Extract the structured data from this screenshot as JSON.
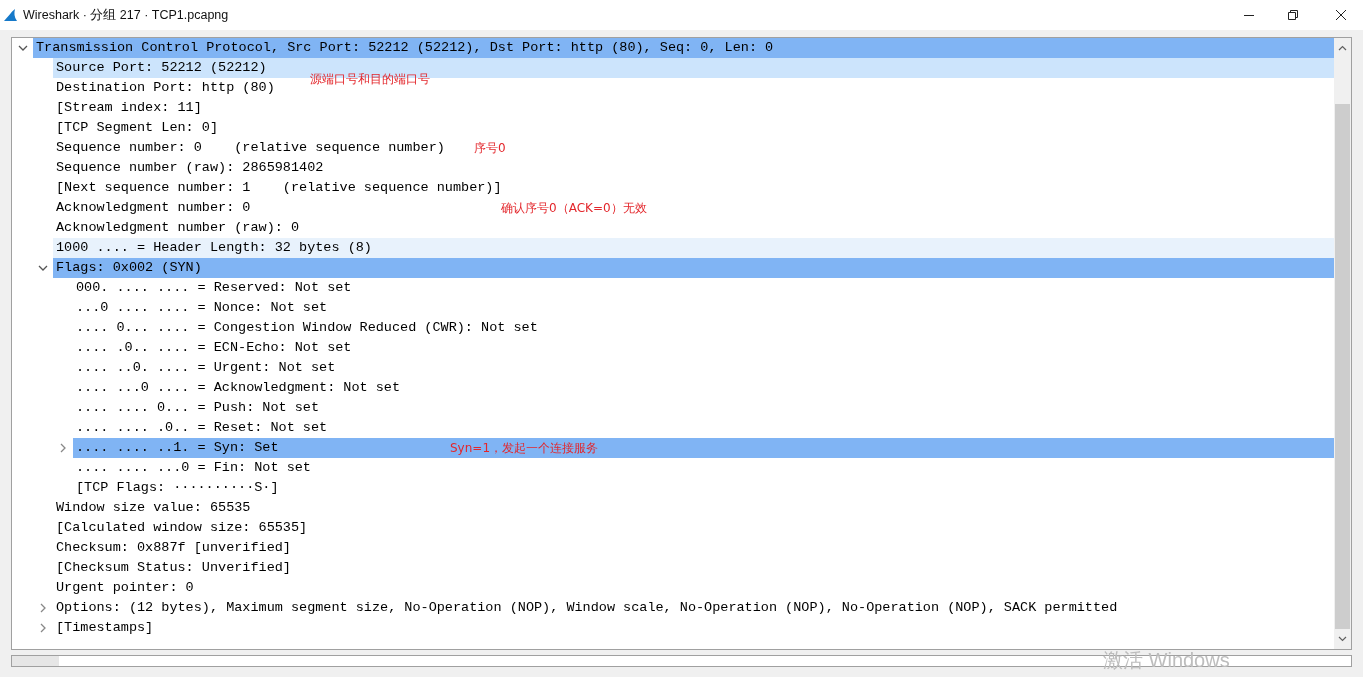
{
  "window": {
    "title": "Wireshark · 分组 217 · TCP1.pcapng"
  },
  "tree": [
    {
      "text": "Transmission Control Protocol, Src Port: 52212 (52212), Dst Port: http (80), Seq: 0, Len: 0",
      "selected": true,
      "expanded": true,
      "children": [
        {
          "text": "Source Port: 52212 (52212)",
          "selected": false,
          "hovered": true,
          "related": false
        },
        {
          "text": "Destination Port: http (80)",
          "selected": false,
          "hovered": false,
          "related": false,
          "note": "源端口号和目的端口号"
        },
        {
          "text": "[Stream index: 11]",
          "selected": false,
          "hovered": false,
          "related": false
        },
        {
          "text": "[TCP Segment Len: 0]",
          "selected": false,
          "hovered": false,
          "related": false
        },
        {
          "text": "Sequence number: 0    (relative sequence number)",
          "selected": false,
          "hovered": false,
          "related": false,
          "note": "序号0"
        },
        {
          "text": "Sequence number (raw): 2865981402",
          "selected": false,
          "hovered": false,
          "related": false
        },
        {
          "text": "[Next sequence number: 1    (relative sequence number)]",
          "selected": false,
          "hovered": false,
          "related": false
        },
        {
          "text": "Acknowledgment number: 0",
          "selected": false,
          "hovered": false,
          "related": false,
          "note": "确认序号0（ACK=0）无效"
        },
        {
          "text": "Acknowledgment number (raw): 0",
          "selected": false,
          "hovered": false,
          "related": false
        },
        {
          "text": "1000 .... = Header Length: 32 bytes (8)",
          "selected": false,
          "hovered": false,
          "related": true
        },
        {
          "text": "Flags: 0x002 (SYN)",
          "selected": true,
          "hovered": false,
          "related": false,
          "expanded": true,
          "children": [
            {
              "text": "000. .... .... = Reserved: Not set",
              "selected": false
            },
            {
              "text": "...0 .... .... = Nonce: Not set",
              "selected": false
            },
            {
              "text": ".... 0... .... = Congestion Window Reduced (CWR): Not set",
              "selected": false
            },
            {
              "text": ".... .0.. .... = ECN-Echo: Not set",
              "selected": false
            },
            {
              "text": ".... ..0. .... = Urgent: Not set",
              "selected": false
            },
            {
              "text": ".... ...0 .... = Acknowledgment: Not set",
              "selected": false
            },
            {
              "text": ".... .... 0... = Push: Not set",
              "selected": false
            },
            {
              "text": ".... .... .0.. = Reset: Not set",
              "selected": false
            },
            {
              "text": ".... .... ..1. = Syn: Set",
              "selected": true,
              "expanded": false,
              "note": "Syn=1，发起一个连接服务"
            },
            {
              "text": ".... .... ...0 = Fin: Not set",
              "selected": false
            },
            {
              "text": "[TCP Flags: ··········S·]",
              "selected": false
            }
          ]
        },
        {
          "text": "Window size value: 65535",
          "selected": false,
          "hovered": false,
          "related": false
        },
        {
          "text": "[Calculated window size: 65535]",
          "selected": false,
          "hovered": false,
          "related": false
        },
        {
          "text": "Checksum: 0x887f [unverified]",
          "selected": false,
          "hovered": false,
          "related": false
        },
        {
          "text": "[Checksum Status: Unverified]",
          "selected": false,
          "hovered": false,
          "related": false
        },
        {
          "text": "Urgent pointer: 0",
          "selected": false,
          "hovered": false,
          "related": false
        },
        {
          "text": "Options: (12 bytes), Maximum segment size, No-Operation (NOP), Window scale, No-Operation (NOP), No-Operation (NOP), SACK permitted",
          "selected": false,
          "hovered": false,
          "related": false,
          "expanded": false
        },
        {
          "text": "[Timestamps]",
          "selected": false,
          "hovered": false,
          "related": false,
          "expanded": false
        }
      ]
    }
  ],
  "activation_notice": "激活 Windows"
}
